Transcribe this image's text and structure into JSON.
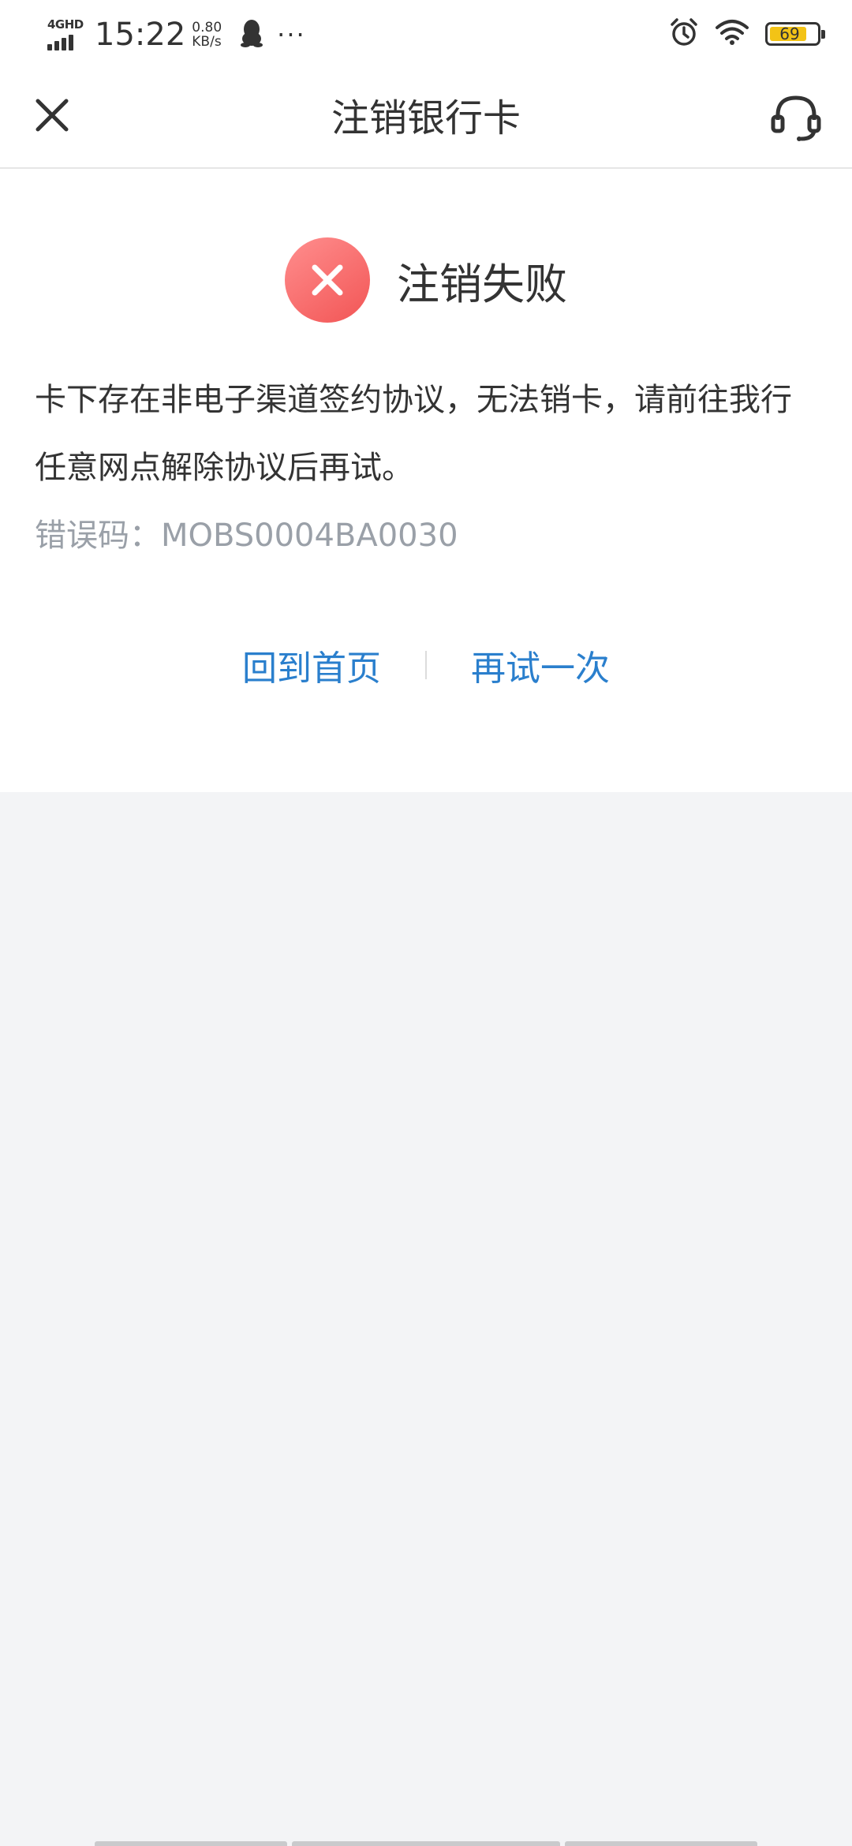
{
  "status_bar": {
    "network": "4GHD",
    "time": "15:22",
    "speed_value": "0.80",
    "speed_unit": "KB/s",
    "more": "···",
    "battery": "69",
    "icons": [
      "signal-icon",
      "qq-icon",
      "alarm-icon",
      "wifi-icon",
      "battery-icon"
    ]
  },
  "nav": {
    "title": "注销银行卡",
    "icons": [
      "close-icon",
      "customer-service-icon"
    ]
  },
  "result": {
    "title": "注销失败",
    "message": "卡下存在非电子渠道签约协议，无法销卡，请前往我行任意网点解除协议后再试。",
    "error_code": "错误码：MOBS0004BA0030",
    "icon": "error-icon"
  },
  "actions": {
    "home_label": "回到首页",
    "retry_label": "再试一次"
  },
  "colors": {
    "accent_link": "#2a7fcd",
    "error_red": "#f25555",
    "battery_fill": "#f3c316",
    "page_background": "#f3f4f6"
  }
}
